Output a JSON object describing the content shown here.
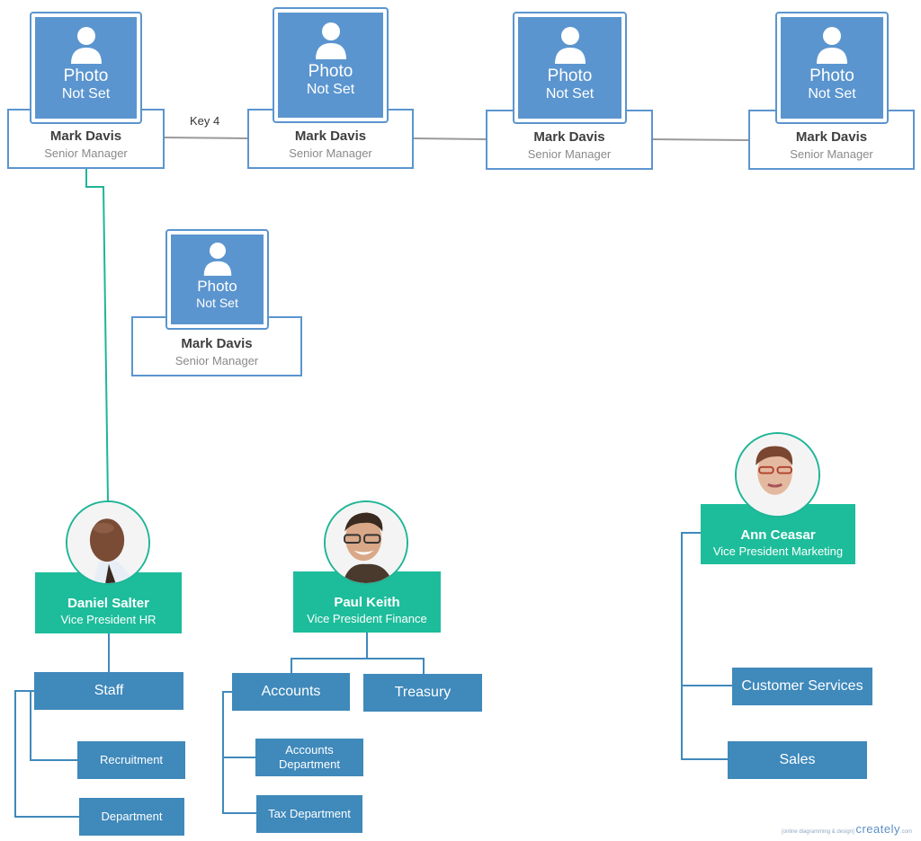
{
  "diagram": {
    "type": "org-chart",
    "colors": {
      "manager_border": "#5b95cf",
      "photo_fill": "#5b95cf",
      "vp_fill": "#1dbd9b",
      "vp_ring": "#1fb596",
      "dept_fill": "#3f89bb",
      "link_gray": "#9a9a9a",
      "link_teal": "#1fb596",
      "link_blue": "#3f89bb"
    },
    "photo_placeholder": {
      "icon": "person-silhouette-icon",
      "line1": "Photo",
      "line2": "Not Set"
    },
    "managers": [
      {
        "id": "m1",
        "name": "Mark Davis",
        "title": "Senior Manager"
      },
      {
        "id": "m2",
        "name": "Mark Davis",
        "title": "Senior Manager"
      },
      {
        "id": "m3",
        "name": "Mark Davis",
        "title": "Senior Manager"
      },
      {
        "id": "m4",
        "name": "Mark Davis",
        "title": "Senior Manager"
      },
      {
        "id": "m5",
        "name": "Mark Davis",
        "title": "Senior Manager"
      }
    ],
    "connector_label": "Key 4",
    "vps": [
      {
        "id": "vp-hr",
        "name": "Daniel Salter",
        "title": "Vice President HR",
        "avatar": "photo-man-bald",
        "departments": [
          {
            "label": "Staff"
          },
          {
            "label": "Recruitment"
          },
          {
            "label": "Department"
          }
        ]
      },
      {
        "id": "vp-finance",
        "name": "Paul Keith",
        "title": "Vice President Finance",
        "avatar": "photo-man-glasses",
        "departments": [
          {
            "label": "Accounts"
          },
          {
            "label": "Treasury"
          },
          {
            "label": "Accounts Department"
          },
          {
            "label": "Tax Department"
          }
        ]
      },
      {
        "id": "vp-marketing",
        "name": "Ann Ceasar",
        "title": "Vice President Marketing",
        "avatar": "photo-woman-glasses",
        "departments": [
          {
            "label": "Customer Services"
          },
          {
            "label": "Sales"
          }
        ]
      }
    ],
    "watermark": {
      "tagline": "[online diagramming & design]",
      "brand": "creately",
      "suffix": ".com"
    }
  }
}
